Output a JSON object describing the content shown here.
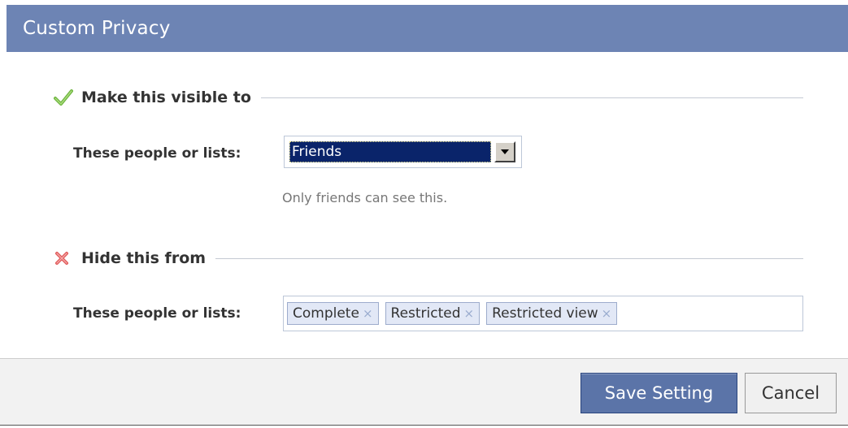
{
  "dialog": {
    "title": "Custom Privacy"
  },
  "visible_section": {
    "icon": "check-icon",
    "title": "Make this visible to",
    "row_label": "These people or lists:",
    "selected_option": "Friends",
    "helper_text": "Only friends can see this."
  },
  "hide_section": {
    "icon": "red-x-icon",
    "title": "Hide this from",
    "row_label": "These people or lists:",
    "tokens": [
      {
        "label": "Complete",
        "remove": "×"
      },
      {
        "label": "Restricted",
        "remove": "×"
      },
      {
        "label": "Restricted view",
        "remove": "×"
      }
    ]
  },
  "footer": {
    "save_label": "Save Setting",
    "cancel_label": "Cancel"
  },
  "colors": {
    "header_bg": "#6d84b4",
    "save_bg": "#5b74a8",
    "token_bg": "#e2e8f6",
    "select_highlight": "#0a246a",
    "check_green": "#6db33f",
    "x_red": "#e05a5a"
  }
}
